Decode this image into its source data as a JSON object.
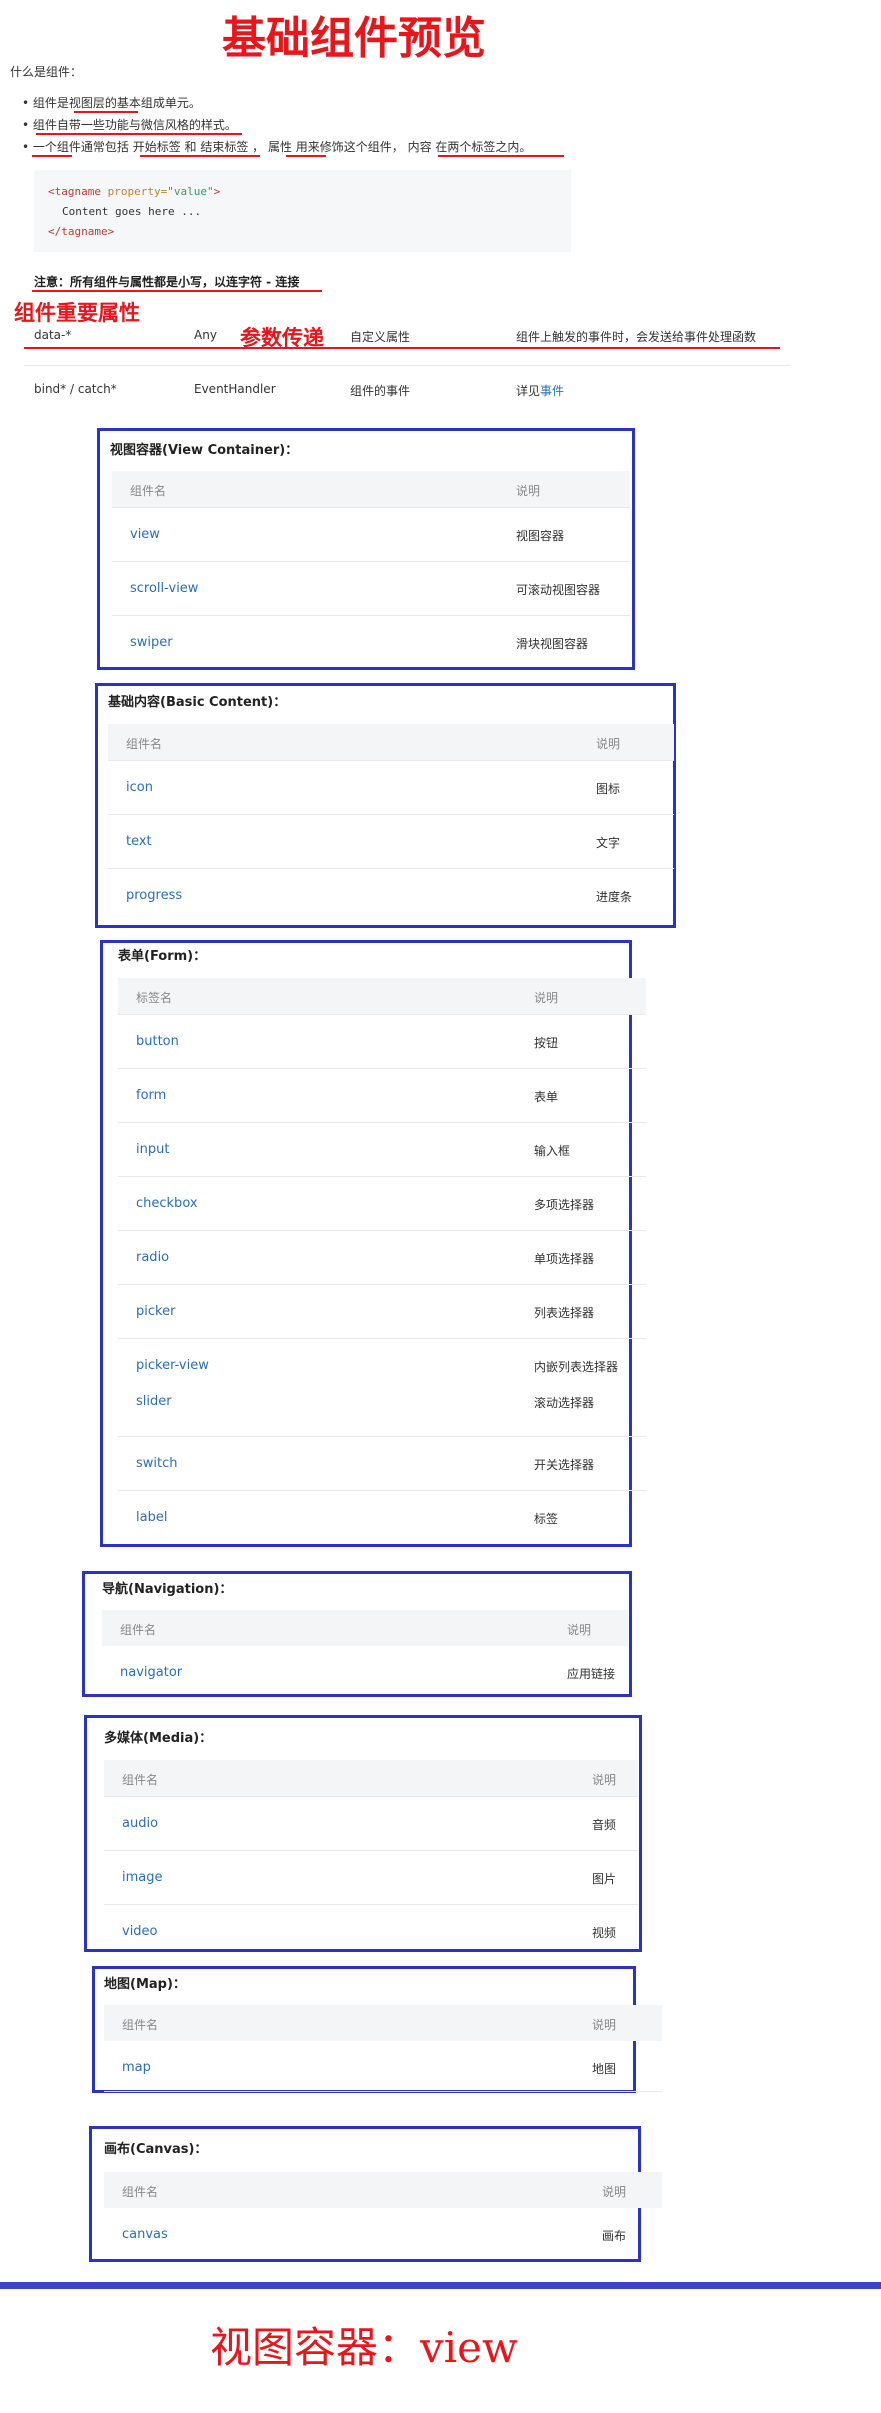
{
  "header": {
    "title": "基础组件预览"
  },
  "intro": {
    "question": "什么是组件：",
    "bullets": [
      "组件是视图层的基本组成单元。",
      "组件自带一些功能与微信风格的样式。",
      "一个组件通常包括 开始标签 和 结束标签 ， 属性 用来修饰这个组件， 内容 在两个标签之内。"
    ],
    "code": {
      "line1_tag_open": "<tagname ",
      "line1_attr": "property=",
      "line1_str": "\"value\"",
      "line1_close": ">",
      "line2": "Content goes here ...",
      "line3": "</tagname>"
    },
    "note": "注意：所有组件与属性都是小写，以连字符 - 连接"
  },
  "annotations": {
    "important_attrs": "组件重要属性",
    "param_passing": "参数传递",
    "bottom_caption": "视图容器：view"
  },
  "attr_table": {
    "rows": [
      {
        "name": "data-*",
        "type": "Any",
        "desc": "自定义属性",
        "note": "组件上触发的事件时，会发送给事件处理函数"
      },
      {
        "name": "bind* / catch*",
        "type": "EventHandler",
        "desc": "组件的事件",
        "note_prefix": "详见",
        "note_link": "事件"
      }
    ]
  },
  "sections": {
    "view_container": {
      "title": "视图容器(View Container)：",
      "header": [
        "组件名",
        "说明"
      ],
      "rows": [
        [
          "view",
          "视图容器"
        ],
        [
          "scroll-view",
          "可滚动视图容器"
        ],
        [
          "swiper",
          "滑块视图容器"
        ]
      ]
    },
    "basic_content": {
      "title": "基础内容(Basic Content)：",
      "header": [
        "组件名",
        "说明"
      ],
      "rows": [
        [
          "icon",
          "图标"
        ],
        [
          "text",
          "文字"
        ],
        [
          "progress",
          "进度条"
        ]
      ]
    },
    "form": {
      "title": "表单(Form)：",
      "header": [
        "标签名",
        "说明"
      ],
      "rows": [
        [
          "button",
          "按钮"
        ],
        [
          "form",
          "表单"
        ],
        [
          "input",
          "输入框"
        ],
        [
          "checkbox",
          "多项选择器"
        ],
        [
          "radio",
          "单项选择器"
        ],
        [
          "picker",
          "列表选择器"
        ],
        [
          "picker-view",
          "内嵌列表选择器"
        ],
        [
          "slider",
          "滚动选择器"
        ],
        [
          "switch",
          "开关选择器"
        ],
        [
          "label",
          "标签"
        ]
      ]
    },
    "navigation": {
      "title": "导航(Navigation)：",
      "header": [
        "组件名",
        "说明"
      ],
      "rows": [
        [
          "navigator",
          "应用链接"
        ]
      ]
    },
    "media": {
      "title": "多媒体(Media)：",
      "header": [
        "组件名",
        "说明"
      ],
      "rows": [
        [
          "audio",
          "音频"
        ],
        [
          "image",
          "图片"
        ],
        [
          "video",
          "视频"
        ]
      ]
    },
    "map": {
      "title": "地图(Map)：",
      "header": [
        "组件名",
        "说明"
      ],
      "rows": [
        [
          "map",
          "地图"
        ]
      ]
    },
    "canvas": {
      "title": "画布(Canvas)：",
      "header": [
        "组件名",
        "说明"
      ],
      "rows": [
        [
          "canvas",
          "画布"
        ]
      ]
    }
  }
}
